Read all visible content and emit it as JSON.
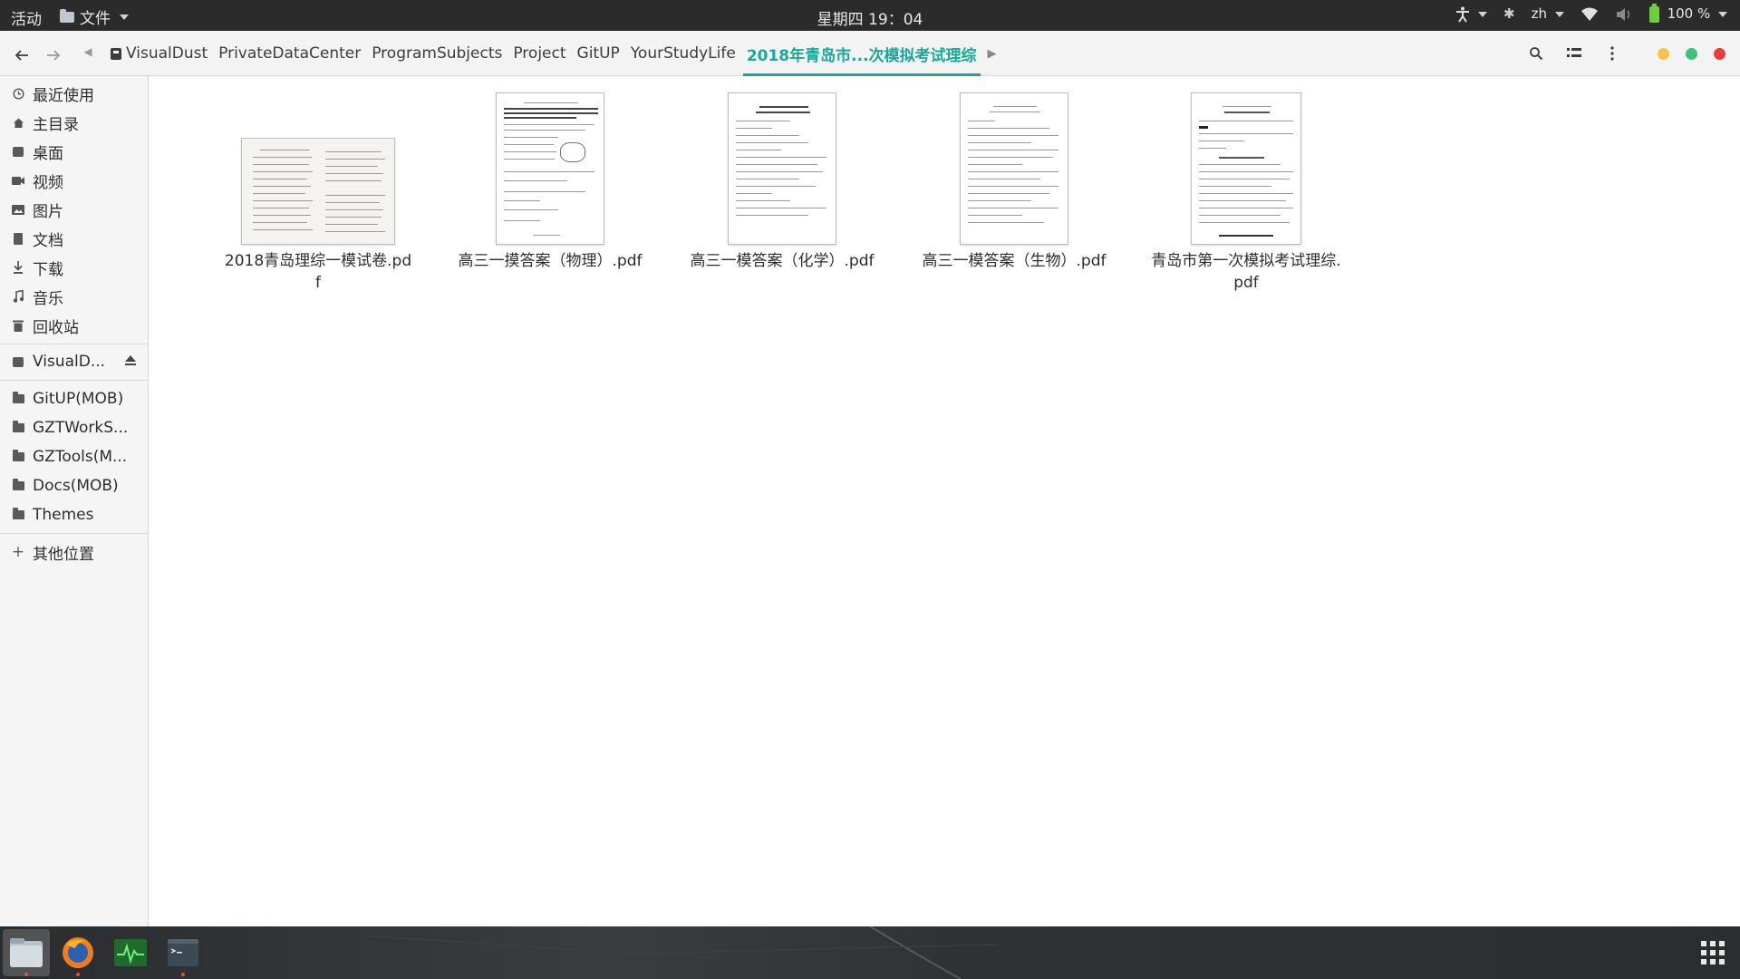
{
  "topbar": {
    "activities": "活动",
    "app_menu": "文件",
    "clock": "星期四 19：04",
    "input_method": "zh",
    "battery": "100 %"
  },
  "header": {
    "breadcrumbs": [
      {
        "label": "VisualDust"
      },
      {
        "label": "PrivateDataCenter"
      },
      {
        "label": "ProgramSubjects"
      },
      {
        "label": "Project"
      },
      {
        "label": "GitUP"
      },
      {
        "label": "YourStudyLife"
      },
      {
        "label": "2018年青岛市...次模拟考试理综"
      }
    ]
  },
  "sidebar": {
    "places": [
      {
        "label": "最近使用",
        "icon": "clock-icon"
      },
      {
        "label": "主目录",
        "icon": "home-icon"
      },
      {
        "label": "桌面",
        "icon": "desktop-icon"
      },
      {
        "label": "视频",
        "icon": "video-icon"
      },
      {
        "label": "图片",
        "icon": "image-icon"
      },
      {
        "label": "文档",
        "icon": "document-icon"
      },
      {
        "label": "下载",
        "icon": "download-icon"
      },
      {
        "label": "音乐",
        "icon": "music-icon"
      },
      {
        "label": "回收站",
        "icon": "trash-icon"
      }
    ],
    "device": {
      "label": "VisualD...",
      "icon": "drive-icon"
    },
    "bookmarks": [
      {
        "label": "GitUP(MOB)"
      },
      {
        "label": "GZTWorkS..."
      },
      {
        "label": "GZTools(M..."
      },
      {
        "label": "Docs(MOB)"
      },
      {
        "label": "Themes"
      }
    ],
    "other_locations": "其他位置"
  },
  "files": [
    {
      "name": "2018青岛理综一模试卷.pdf",
      "thumb": "landscape"
    },
    {
      "name": "高三一摸答案（物理）.pdf",
      "thumb": "portrait"
    },
    {
      "name": "高三一模答案（化学）.pdf",
      "thumb": "portrait"
    },
    {
      "name": "高三一模答案（生物）.pdf",
      "thumb": "portrait"
    },
    {
      "name": "青岛市第一次模拟考试理综.pdf",
      "thumb": "portrait"
    }
  ],
  "dock": {
    "apps": [
      {
        "name": "files",
        "icon": "files-icon"
      },
      {
        "name": "firefox",
        "icon": "firefox-icon"
      },
      {
        "name": "system-monitor",
        "icon": "system-monitor-icon"
      },
      {
        "name": "terminal",
        "icon": "terminal-icon"
      }
    ]
  },
  "colors": {
    "accent": "#18a999",
    "topbar": "#2b2b2b",
    "win_minimize": "#f6c544",
    "win_maximize": "#3cc37a",
    "win_close": "#ef3b3b"
  }
}
